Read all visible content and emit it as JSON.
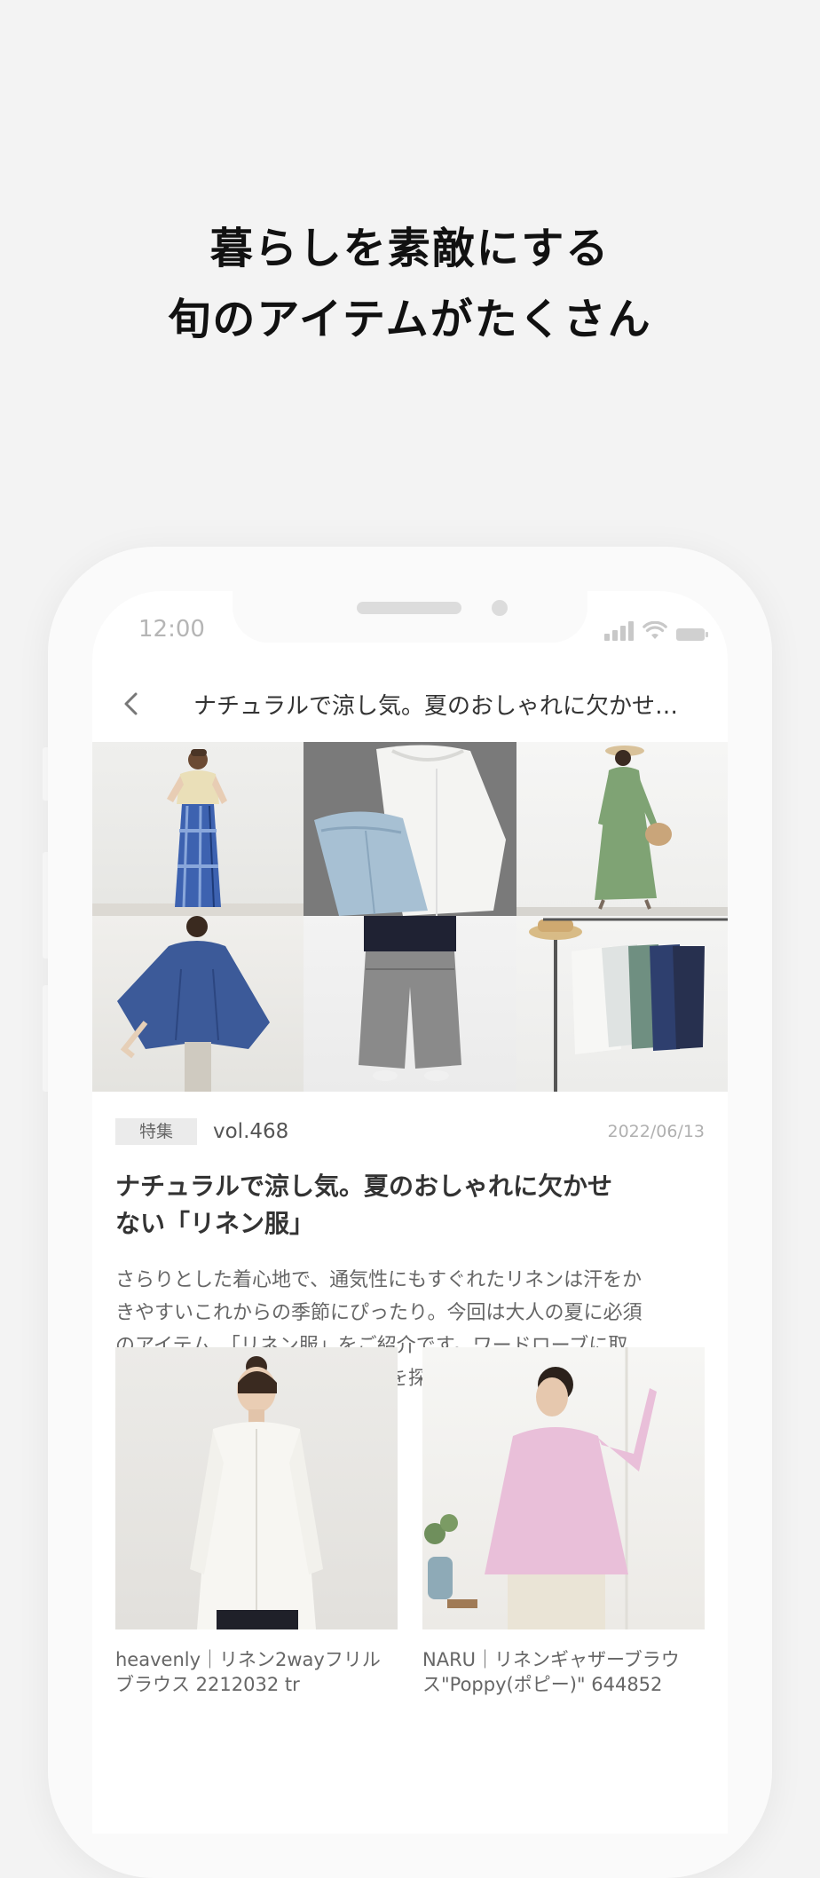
{
  "headline": {
    "line1": "暮らしを素敵にする",
    "line2": "旬のアイテムがたくさん"
  },
  "status_bar": {
    "time": "12:00",
    "icons": [
      "signal-icon",
      "wifi-icon",
      "battery-icon"
    ]
  },
  "navbar": {
    "back_icon": "chevron-left-icon",
    "title": "ナチュラルで涼し気。夏のおしゃれに欠かせ…"
  },
  "article": {
    "tag": "特集",
    "vol": "vol.468",
    "date": "2022/06/13",
    "title_line1": "ナチュラルで涼し気。夏のおしゃれに欠かせ",
    "title_line2": "ない「リネン服」",
    "lead_lines": [
      "さらりとした着心地で、通気性にもすぐれたリネンは汗をか",
      "きやすいこれからの季節にぴったり。今回は大人の夏に必須",
      "のアイテム、「リネン服」をご紹介です。ワードローブに取",
      "り入れたい、お気に入りの一着を探してみてくださいね。"
    ]
  },
  "products": [
    {
      "name_line1": "heavenly｜リネン2wayフリル",
      "name_line2": "ブラウス 2212032 tr"
    },
    {
      "name_line1": "NARU｜リネンギャザーブラウ",
      "name_line2": "ス\"Poppy(ポピー)\" 644852"
    }
  ],
  "colors": {
    "background": "#f3f3f3",
    "text": "#333333",
    "muted": "#999999"
  }
}
